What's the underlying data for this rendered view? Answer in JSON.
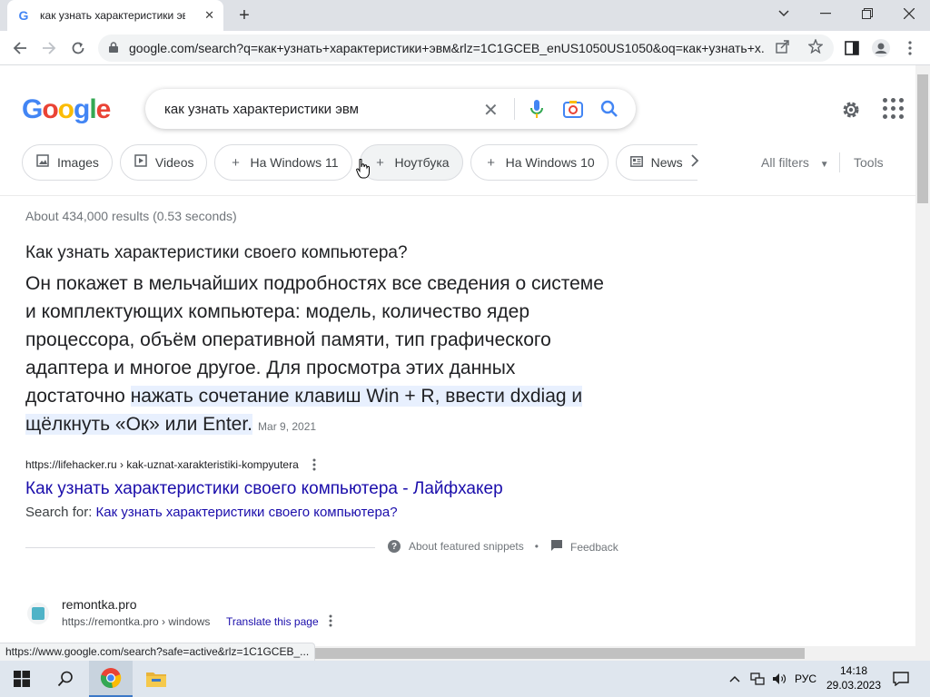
{
  "browser": {
    "tab_title": "как узнать характеристики эвм",
    "url": "google.com/search?q=как+узнать+характеристики+эвм&rlz=1C1GCEB_enUS1050US1050&oq=как+узнать+х..."
  },
  "search": {
    "query": "как узнать характеристики эвм"
  },
  "chips": [
    {
      "label": "Images",
      "icon": "image-icon"
    },
    {
      "label": "Videos",
      "icon": "play-icon"
    },
    {
      "label": "На Windows 11",
      "icon": "plus-icon"
    },
    {
      "label": "Ноутбука",
      "icon": "plus-icon"
    },
    {
      "label": "На Windows 10",
      "icon": "plus-icon"
    },
    {
      "label": "News",
      "icon": "news-icon"
    }
  ],
  "filters": {
    "all_filters": "All filters",
    "tools": "Tools"
  },
  "results": {
    "stats": "About 434,000 results (0.53 seconds)",
    "featured_snippet": {
      "question": "Как узнать характеристики своего компьютера?",
      "answer_plain": "Он покажет в мельчайших подробностях все сведения о системе и комплектующих компьютера: модель, количество ядер процессора, объём оперативной памяти, тип графического адаптера и многое другое. Для просмотра этих данных достаточно ",
      "answer_highlight": "нажать сочетание клавиш Win + R, ввести dxdiag и щёлкнуть «Ок» или Enter.",
      "date": "Mar 9, 2021",
      "source_url": "https://lifehacker.ru › kak-uznat-xarakteristiki-kompyutera",
      "source_title": "Как узнать характеристики своего компьютера - Лайфхакер",
      "search_for_label": "Search for:",
      "search_for_link": "Как узнать характеристики своего компьютера?",
      "about": "About featured snippets",
      "feedback": "Feedback"
    },
    "second": {
      "site": "remontka.pro",
      "url": "https://remontka.pro › windows",
      "translate": "Translate this page"
    }
  },
  "status_bar": "https://www.google.com/search?safe=active&rlz=1C1GCEB_...",
  "taskbar": {
    "language": "РУС",
    "time": "14:18",
    "date": "29.03.2023"
  }
}
